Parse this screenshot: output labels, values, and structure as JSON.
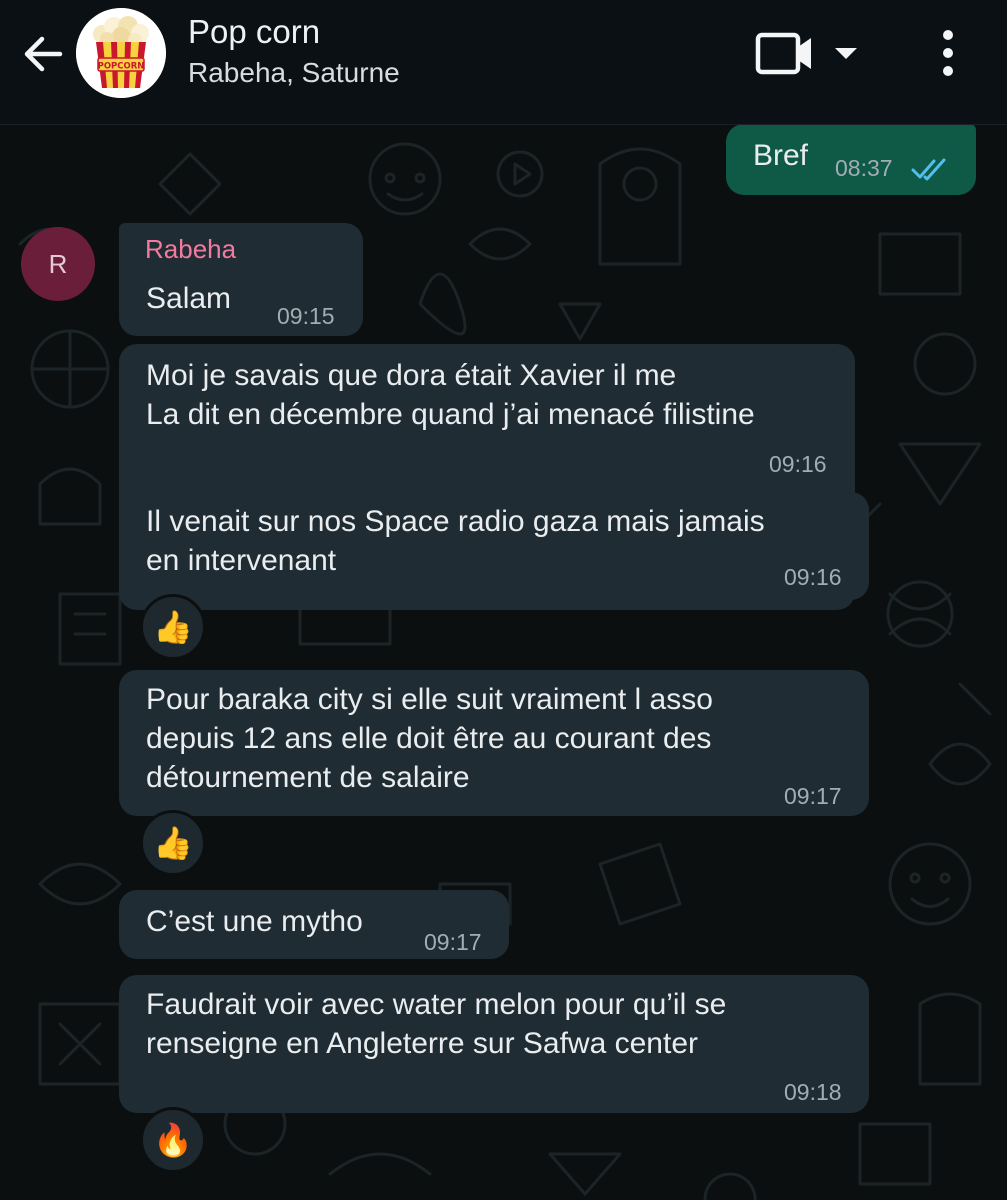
{
  "header": {
    "title": "Pop corn",
    "subtitle": "Rabeha, Saturne",
    "avatar_text": "POPCORN",
    "back_icon": "arrow-left-icon",
    "video_icon": "video-camera-icon",
    "dropdown_icon": "caret-down-icon",
    "menu_icon": "more-vertical-icon"
  },
  "colors": {
    "incoming_bubble": "#202c33",
    "outgoing_bubble": "#0f5a46",
    "sender_name": "#f27aa0",
    "read_ticks": "#53bdeb",
    "sender_avatar": "#6b1e3a"
  },
  "sender_avatar_initial": "R",
  "messages": [
    {
      "direction": "out",
      "text": "Bref",
      "time": "08:37",
      "status": "read"
    },
    {
      "direction": "in",
      "sender": "Rabeha",
      "text": "Salam",
      "time": "09:15"
    },
    {
      "direction": "in",
      "text": "Moi je savais que dora était Xavier il me\nLa dit en décembre quand j’ai menacé filistine",
      "time": "09:16"
    },
    {
      "direction": "in",
      "text": "Il venait sur nos Space radio gaza mais jamais\nen intervenant",
      "time": "09:16",
      "reaction": "👍"
    },
    {
      "direction": "in",
      "text": "Pour baraka city si elle suit vraiment l asso\ndepuis 12 ans elle doit être au courant des\ndétournement de salaire",
      "time": "09:17",
      "reaction": "👍"
    },
    {
      "direction": "in",
      "text": "C’est une mytho",
      "time": "09:17"
    },
    {
      "direction": "in",
      "text": "Faudrait voir avec water melon pour qu’il se\nrenseigne en Angleterre sur Safwa center",
      "time": "09:18",
      "reaction": "🔥"
    }
  ]
}
